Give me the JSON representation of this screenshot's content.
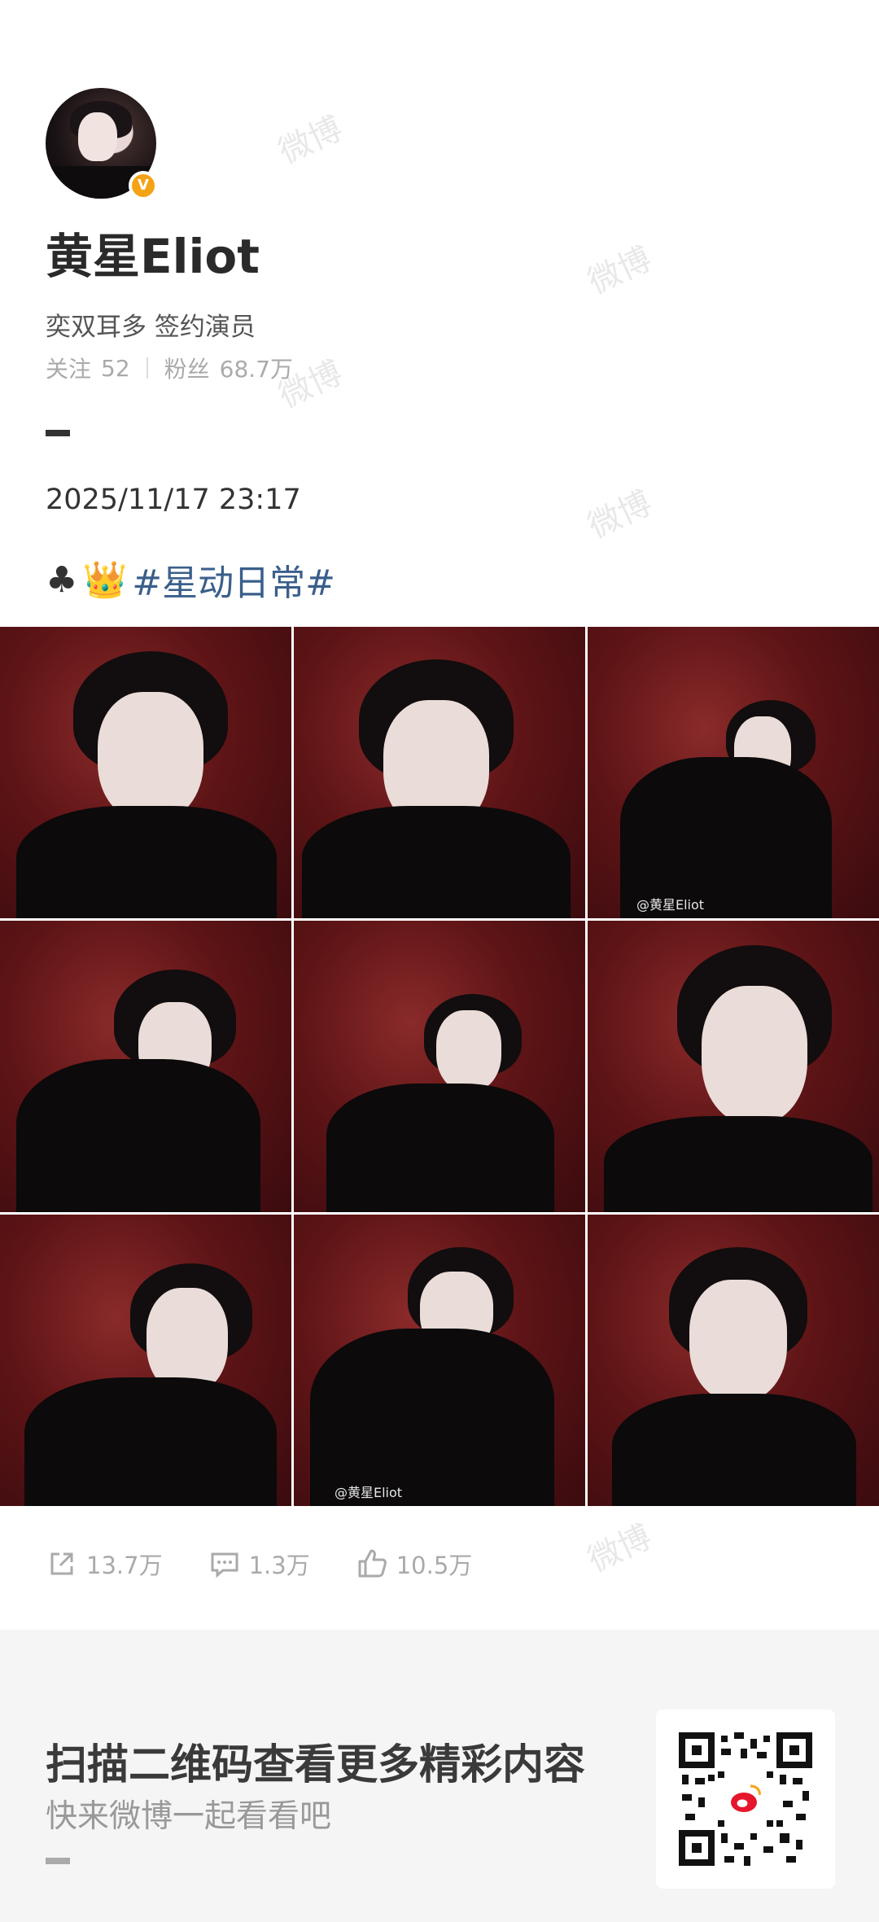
{
  "profile": {
    "name": "黄星Eliot",
    "bio": "奕双耳多  签约演员",
    "following_label": "关注",
    "following_count": "52",
    "followers_label": "粉丝",
    "followers_count": "68.7万",
    "verified_badge": "V"
  },
  "post": {
    "date": "2025/11/17  23:17",
    "club_icon": "♣",
    "crown_icon": "👑",
    "hashtag": "#星动日常#",
    "photo_watermark": "@黄星Eliot",
    "photo_count": 9
  },
  "actions": {
    "share_count": "13.7万",
    "comment_count": "1.3万",
    "like_count": "10.5万"
  },
  "footer": {
    "title": "扫描二维码查看更多精彩内容",
    "subtitle": "快来微博一起看看吧"
  },
  "watermark": "微博"
}
